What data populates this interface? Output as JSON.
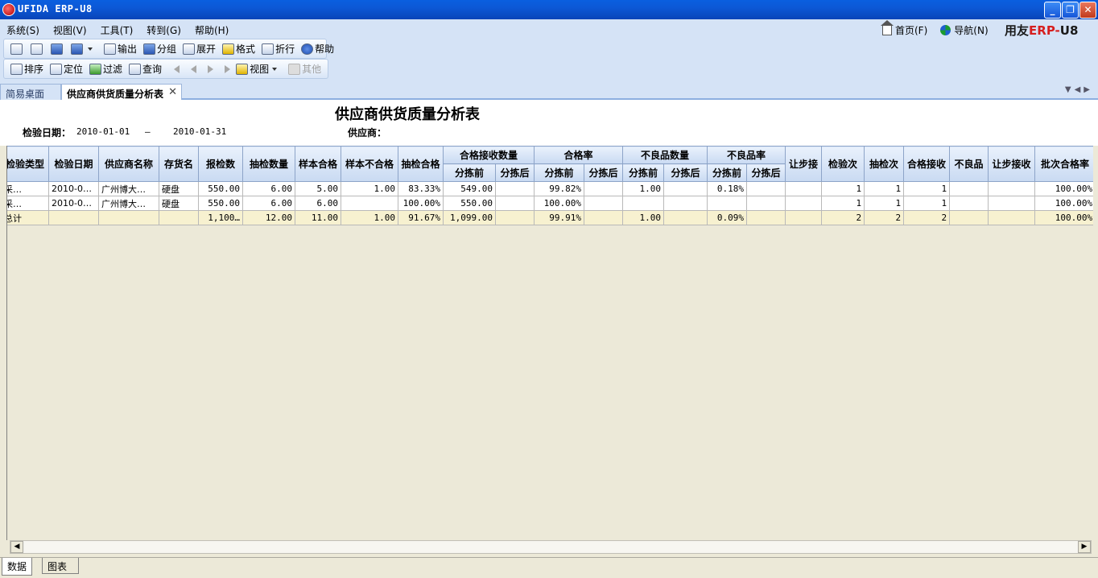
{
  "window": {
    "title": "UFIDA ERP-U8",
    "minimize": "_",
    "restore": "❐",
    "close": "✕"
  },
  "menu": [
    "系统(S)",
    "视图(V)",
    "工具(T)",
    "转到(G)",
    "帮助(H)"
  ],
  "right_links": {
    "home": "首页(F)",
    "nav": "导航(N)",
    "brand_prefix": "用友",
    "brand_erp": "ERP-",
    "brand_u8": "U8"
  },
  "toolbar1": [
    "输出",
    "分组",
    "展开",
    "格式",
    "折行",
    "帮助"
  ],
  "toolbar2": {
    "sort": "排序",
    "locate": "定位",
    "filter": "过滤",
    "query": "查询",
    "view": "视图",
    "other": "其他"
  },
  "tabs": {
    "desktop": "简易桌面",
    "report": "供应商供货质量分析表",
    "close": "✕"
  },
  "report": {
    "title": "供应商供货质量分析表",
    "date_label": "检验日期：",
    "date_from": "2010-01-01",
    "date_sep": "—",
    "date_to": "2010-01-31",
    "supplier_label": "供应商："
  },
  "grid": {
    "headers": [
      "检验类型",
      "检验日期",
      "供应商名称",
      "存货名",
      "报检数",
      "抽检数量",
      "样本合格",
      "样本不合格",
      "抽检合格",
      "合格接收数量",
      "合格率",
      "不良品数量",
      "不良品率",
      "让步接",
      "检验次",
      "抽检次",
      "合格接收",
      "不良品",
      "让步接收",
      "批次合格率"
    ],
    "subheaders": [
      "分拣前",
      "分拣后",
      "分拣前",
      "分拣后",
      "分拣前",
      "分拣后",
      "分拣前",
      "分拣后"
    ],
    "rows": [
      [
        "采…",
        "2010-0…",
        "广州博大…",
        "硬盘",
        "550.00",
        "6.00",
        "5.00",
        "1.00",
        "83.33%",
        "549.00",
        "",
        "99.82%",
        "",
        "1.00",
        "",
        "0.18%",
        "",
        "",
        "1",
        "1",
        "1",
        "",
        "",
        "100.00%"
      ],
      [
        "采…",
        "2010-0…",
        "广州博大…",
        "硬盘",
        "550.00",
        "6.00",
        "6.00",
        "",
        "100.00%",
        "550.00",
        "",
        "100.00%",
        "",
        "",
        "",
        "",
        "",
        "",
        "1",
        "1",
        "1",
        "",
        "",
        "100.00%"
      ]
    ],
    "total": [
      "总计",
      "",
      "",
      "",
      "1,100…",
      "12.00",
      "11.00",
      "1.00",
      "91.67%",
      "1,099.00",
      "",
      "99.91%",
      "",
      "1.00",
      "",
      "0.09%",
      "",
      "",
      "2",
      "2",
      "2",
      "",
      "",
      "100.00%"
    ]
  },
  "sheets": {
    "data": "数据",
    "chart": "图表"
  },
  "scroll": {
    "left": "◀",
    "right": "▶"
  }
}
